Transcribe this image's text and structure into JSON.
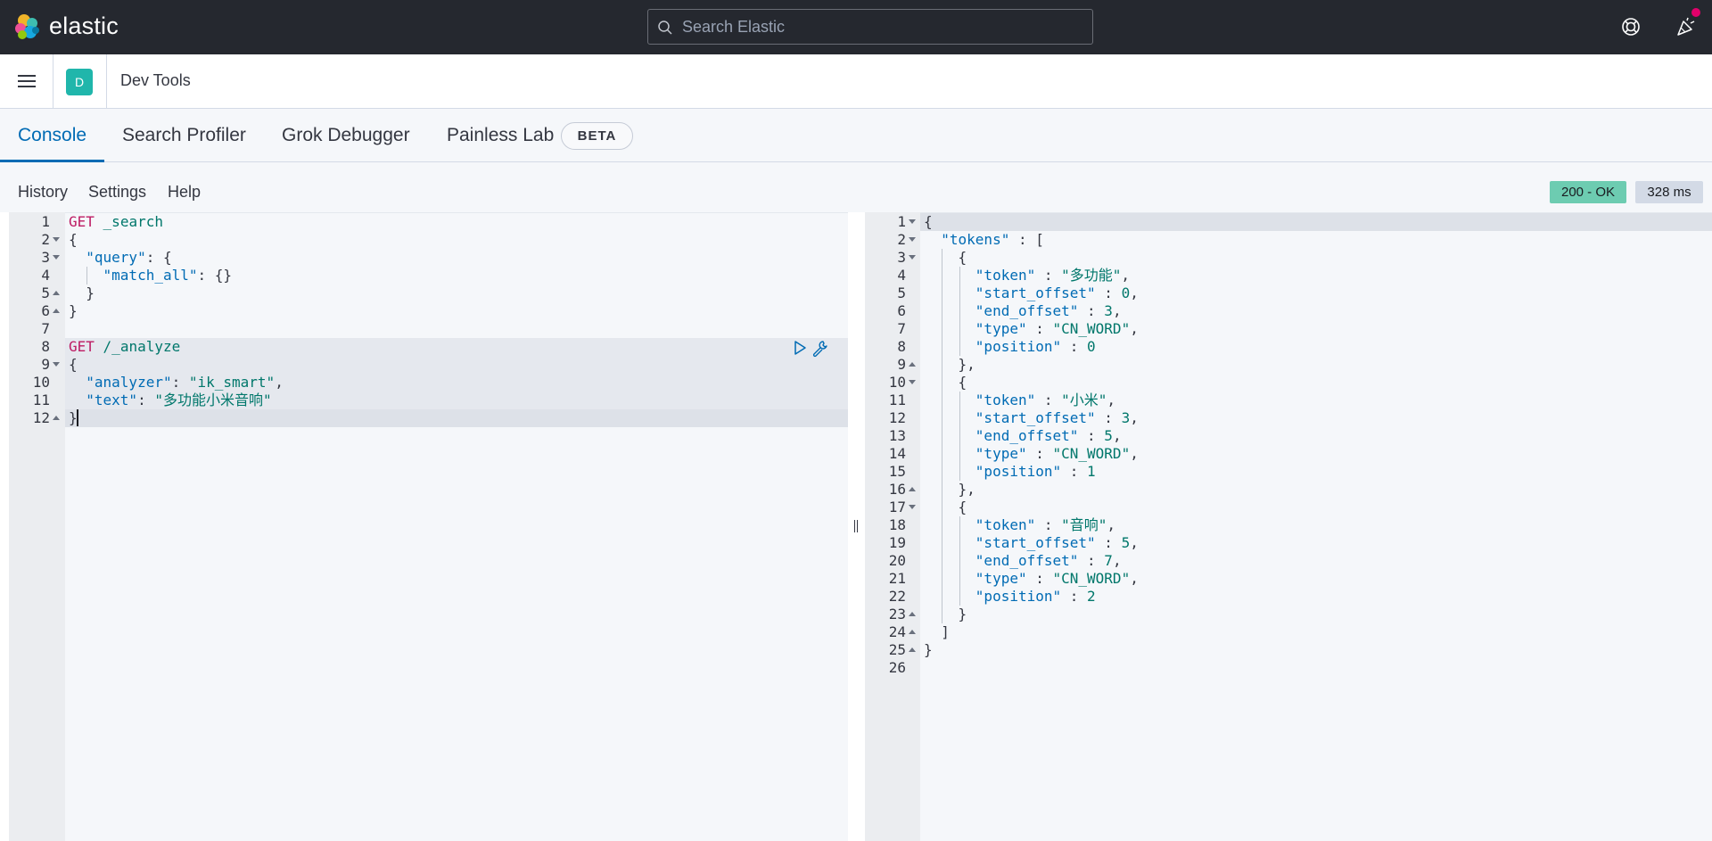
{
  "header": {
    "brand": "elastic",
    "search_placeholder": "Search Elastic"
  },
  "app": {
    "space_initial": "D",
    "breadcrumb": "Dev Tools"
  },
  "tabs": [
    {
      "label": "Console",
      "active": true
    },
    {
      "label": "Search Profiler",
      "active": false
    },
    {
      "label": "Grok Debugger",
      "active": false
    },
    {
      "label": "Painless Lab",
      "active": false,
      "badge": "BETA"
    }
  ],
  "toolbar": {
    "history": "History",
    "settings": "Settings",
    "help": "Help",
    "status": "200 - OK",
    "duration": "328 ms"
  },
  "request_editor": {
    "lines": [
      "GET _search",
      "{",
      "  \"query\": {",
      "    \"match_all\": {}",
      "  }",
      "}",
      "",
      "GET /_analyze",
      "{",
      "  \"analyzer\": \"ik_smart\",",
      "  \"text\": \"多功能小米音响\"",
      "}"
    ]
  },
  "response_editor": {
    "lines": [
      "{",
      "  \"tokens\" : [",
      "    {",
      "      \"token\" : \"多功能\",",
      "      \"start_offset\" : 0,",
      "      \"end_offset\" : 3,",
      "      \"type\" : \"CN_WORD\",",
      "      \"position\" : 0",
      "    },",
      "    {",
      "      \"token\" : \"小米\",",
      "      \"start_offset\" : 3,",
      "      \"end_offset\" : 5,",
      "      \"type\" : \"CN_WORD\",",
      "      \"position\" : 1",
      "    },",
      "    {",
      "      \"token\" : \"音响\",",
      "      \"start_offset\" : 5,",
      "      \"end_offset\" : 7,",
      "      \"type\" : \"CN_WORD\",",
      "      \"position\" : 2",
      "    }",
      "  ]",
      "}",
      ""
    ]
  },
  "colors": {
    "header_bg": "#25282f",
    "accent": "#006bb4",
    "status_ok": "#6dccb1",
    "space_avatar": "#20b6ab",
    "method": "#bd1b63",
    "string": "#00776b"
  }
}
